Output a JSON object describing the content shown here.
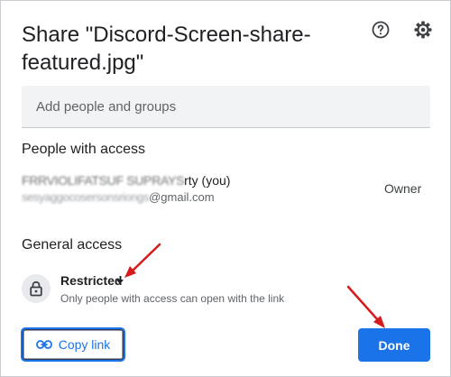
{
  "dialog": {
    "title": "Share \"Discord-Screen-share-featured.jpg\"",
    "help_icon": "help-circle-icon",
    "settings_icon": "gear-icon"
  },
  "add_people": {
    "placeholder": "Add people and groups",
    "value": ""
  },
  "people_section": {
    "heading": "People with access",
    "owner": {
      "name_redacted": "FRRVIOLIFATSUF SUPRAYS",
      "name_suffix": "rty (you)",
      "email_redacted": "sesyaggocosersonsriongs",
      "email_suffix": "@gmail.com",
      "role": "Owner"
    }
  },
  "general_access": {
    "heading": "General access",
    "icon": "lock-icon",
    "level": "Restricted",
    "description": "Only people with access can open with the link"
  },
  "footer": {
    "copy_link_label": "Copy link",
    "copy_link_icon": "link-icon",
    "done_label": "Done"
  },
  "annotations": {
    "arrow_color": "#d7191c"
  },
  "colors": {
    "accent": "#1a73e8",
    "field_bg": "#f1f3f4",
    "lock_bg": "#e8eaed"
  }
}
